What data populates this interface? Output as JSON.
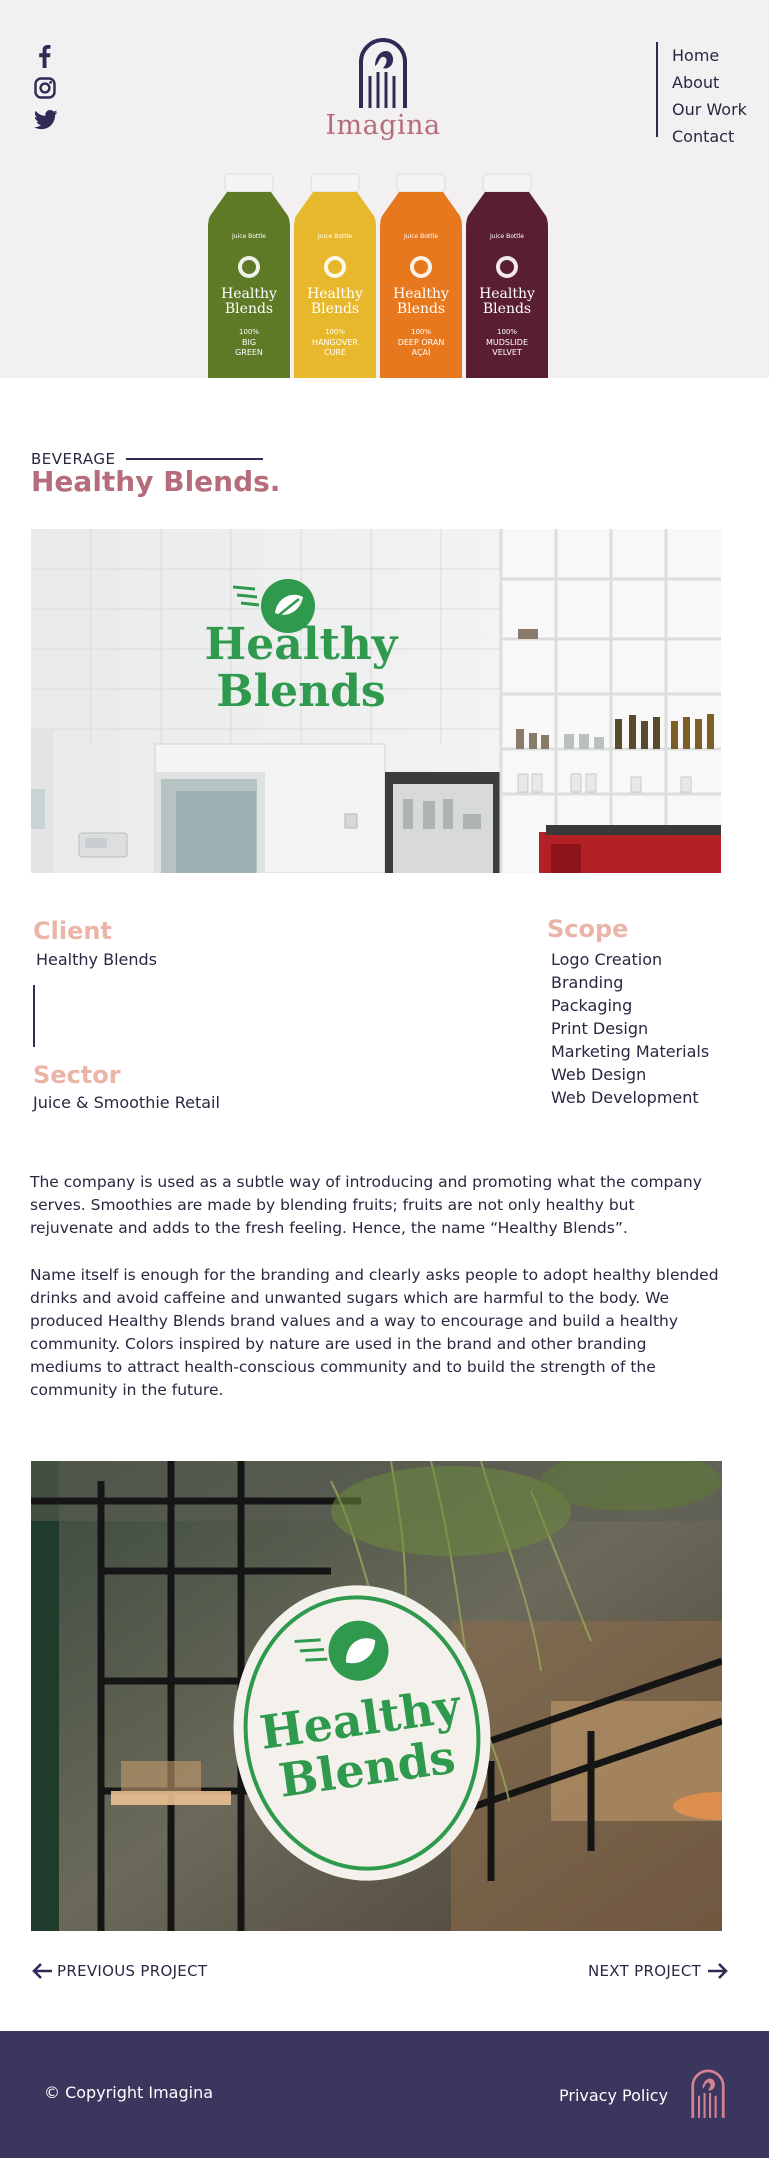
{
  "header": {
    "brand": "Imagina",
    "nav": [
      "Home",
      "About",
      "Our Work",
      "Contact"
    ],
    "social": [
      "facebook-icon",
      "instagram-icon",
      "twitter-icon"
    ]
  },
  "hero": {
    "bottles": [
      {
        "top_label": "Juice Bottle",
        "name1": "Healthy",
        "name2": "Blends",
        "pct": "100%",
        "flavor1": "BIG",
        "flavor2": "GREEN",
        "color": "#5e7a26"
      },
      {
        "top_label": "Juice Bottle",
        "name1": "Healthy",
        "name2": "Blends",
        "pct": "100%",
        "flavor1": "HANGOVER",
        "flavor2": "CURE",
        "color": "#e8b82c"
      },
      {
        "top_label": "Juice Bottle",
        "name1": "Healthy",
        "name2": "Blends",
        "pct": "100%",
        "flavor1": "DEEP ORAN",
        "flavor2": "AÇAÍ",
        "color": "#e8781d"
      },
      {
        "top_label": "Juice Bottle",
        "name1": "Healthy",
        "name2": "Blends",
        "pct": "100%",
        "flavor1": "MUDSLIDE",
        "flavor2": "VELVET",
        "color": "#5a1e33"
      }
    ]
  },
  "project": {
    "category": "BEVERAGE",
    "title": "Healthy Blends.",
    "sign_line1": "Healthy",
    "sign_line2": "Blends"
  },
  "details": {
    "client_label": "Client",
    "client_value": "Healthy Blends",
    "sector_label": "Sector",
    "sector_value": "Juice & Smoothie Retail",
    "scope_label": "Scope",
    "scope_items": [
      "Logo Creation",
      "Branding",
      "Packaging",
      "Print Design",
      "Marketing Materials",
      "Web Design",
      "Web Development"
    ]
  },
  "description": {
    "p1": "The company is used as a subtle way of introducing and promoting what the company serves. Smoothies are made by blending fruits; fruits are not only healthy but rejuvenate and adds to the fresh feeling. Hence, the name “Healthy Blends”.",
    "p2": "Name itself is enough for the branding and clearly asks people to adopt healthy blended drinks and avoid caffeine and unwanted sugars which are harmful to the body. We produced Healthy Blends brand values and a way to encourage and build a healthy community.  Colors inspired by nature are used in the brand and other branding mediums to attract health-conscious community and to build the strength of the community in the future."
  },
  "pagination": {
    "prev": "PREVIOUS PROJECT",
    "next": "NEXT PROJECT"
  },
  "footer": {
    "copyright": "© Copyright Imagina",
    "privacy": "Privacy Policy"
  },
  "colors": {
    "accent": "#b66c7b",
    "navy": "#2f2b55",
    "peach": "#eab5a8",
    "footer_bg": "#3a365e",
    "brand_green": "#2f9a4e"
  }
}
